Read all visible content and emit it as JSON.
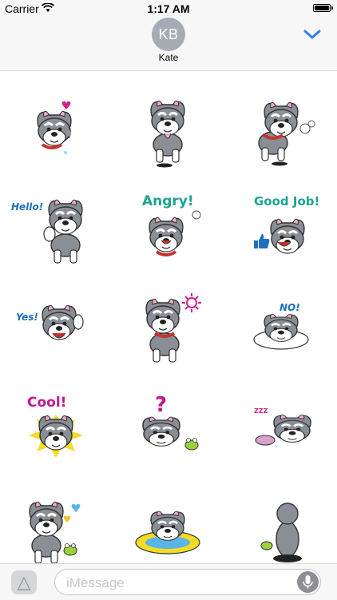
{
  "status_bar": {
    "carrier": "Carrier",
    "time": "1:17 AM",
    "icons": [
      "wifi-icon",
      "battery-icon"
    ]
  },
  "header": {
    "avatar_initials": "KB",
    "contact_name": "Kate",
    "collapse_icon": "chevron-down-icon"
  },
  "stickers": {
    "count": 15,
    "captions": {
      "hello": "Hello!",
      "angry": "Angry!",
      "good_job": "Good Job!",
      "yes": "Yes!",
      "no": "NO!",
      "cool": "Cool!",
      "question": "?",
      "zzz": "ZZZ"
    }
  },
  "composer": {
    "apps_icon": "app-store-icon",
    "placeholder": "iMessage",
    "mic_icon": "microphone-icon"
  },
  "colors": {
    "accent_blue": "#2f7cf6",
    "avatar_gray": "#a7abb4",
    "dog_gray": "#8a8e95",
    "angry_teal": "#1aa58f",
    "cool_magenta": "#c0188f",
    "hello_blue": "#1d6fc1"
  }
}
